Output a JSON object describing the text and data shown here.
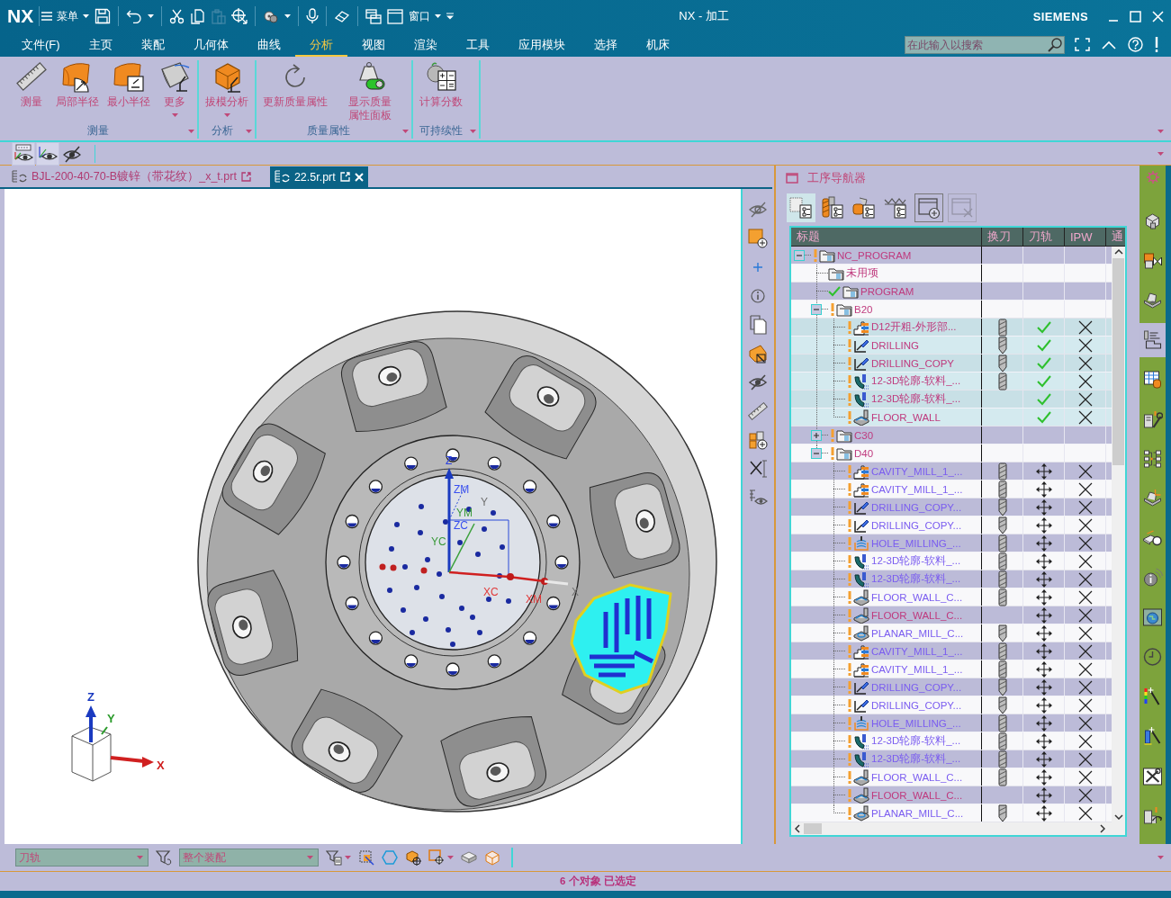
{
  "title_bar": {
    "logo": "NX",
    "menu_label": "菜单",
    "window_label": "窗口",
    "title": "NX - 加工",
    "brand": "SIEMENS"
  },
  "menu_bar": {
    "items": [
      {
        "label": "文件(F)",
        "selected": false
      },
      {
        "label": "主页",
        "selected": false
      },
      {
        "label": "装配",
        "selected": false
      },
      {
        "label": "几何体",
        "selected": false
      },
      {
        "label": "曲线",
        "selected": false
      },
      {
        "label": "分析",
        "selected": true
      },
      {
        "label": "视图",
        "selected": false
      },
      {
        "label": "渲染",
        "selected": false
      },
      {
        "label": "工具",
        "selected": false
      },
      {
        "label": "应用模块",
        "selected": false
      },
      {
        "label": "选择",
        "selected": false
      },
      {
        "label": "机床",
        "selected": false
      }
    ],
    "search": {
      "placeholder": "在此输入以搜索"
    }
  },
  "ribbon": {
    "groups": [
      {
        "label": "测量",
        "buttons": [
          {
            "label": "测量",
            "dropdown": false
          },
          {
            "label": "局部半径",
            "dropdown": false
          },
          {
            "label": "最小半径",
            "dropdown": false
          },
          {
            "label": "更多",
            "dropdown": true
          }
        ]
      },
      {
        "label": "分析",
        "buttons": [
          {
            "label": "拔模分析",
            "dropdown": true
          }
        ]
      },
      {
        "label": "质量属性",
        "buttons": [
          {
            "label": "更新质量属性",
            "dropdown": false
          },
          {
            "label": "显示质量属性面板",
            "dropdown": false
          }
        ]
      },
      {
        "label": "可持续性",
        "buttons": [
          {
            "label": "计算分数",
            "dropdown": false
          }
        ]
      }
    ]
  },
  "display_toolbar": {
    "toggles": [
      {
        "on": true
      },
      {
        "on": true
      },
      {
        "on": false
      }
    ]
  },
  "file_tabs": [
    {
      "label": "BJL-200-40-70-B镀锌（带花纹）_x_t.prt",
      "selected": false
    },
    {
      "label": "22.5r.prt",
      "selected": true
    }
  ],
  "viewport": {
    "axis_labels": [
      {
        "text": "Z",
        "color": "#2a40e0"
      },
      {
        "text": "ZM",
        "color": "#3a50f0"
      },
      {
        "text": "Y",
        "color": "#707070"
      },
      {
        "text": "YM",
        "color": "#3a9a3a"
      },
      {
        "text": "ZC",
        "color": "#3a50f0"
      },
      {
        "text": "YC",
        "color": "#3a9a3a"
      },
      {
        "text": "XC",
        "color": "#e03a3a"
      },
      {
        "text": "XM",
        "color": "#e03a3a"
      },
      {
        "text": "X",
        "color": "#707070"
      }
    ],
    "triad_labels": [
      {
        "text": "Z",
        "color": "#1a3ac0"
      },
      {
        "text": "Y",
        "color": "#2a9a2a"
      },
      {
        "text": "X",
        "color": "#d02020"
      }
    ]
  },
  "navigator": {
    "title": "工序导航器",
    "views": [
      {
        "selected": true
      },
      {
        "selected": false
      },
      {
        "selected": false
      },
      {
        "selected": false
      }
    ],
    "actions": [
      {
        "disabled": false
      },
      {
        "disabled": true
      }
    ],
    "columns": [
      "标题",
      "换刀",
      "刀轨",
      "IPW",
      "通"
    ],
    "rows": [
      {
        "name": "NC_PROGRAM",
        "kind": "folder",
        "warning": true,
        "done": false,
        "expanded": true,
        "selected": false,
        "color": "#bf3a7e",
        "children": [
          {
            "name": "未用项",
            "kind": "folder",
            "warning": false,
            "done": false,
            "selected": false,
            "color": "#bf3a7e"
          },
          {
            "name": "PROGRAM",
            "kind": "folder",
            "warning": false,
            "done": true,
            "selected": false,
            "color": "#bf3a7e"
          },
          {
            "name": "B20",
            "kind": "folder",
            "warning": true,
            "done": false,
            "expanded": true,
            "selected": false,
            "color": "#bf3a7e",
            "children": [
              {
                "name": "D12开粗-外形部...",
                "kind": "cavity",
                "warning": true,
                "done": false,
                "selected": true,
                "color": "#bf3a7e",
                "tool": {
                  "kind": "endmill"
                },
                "regenerate": false
              },
              {
                "name": "DRILLING",
                "kind": "drill",
                "warning": true,
                "done": false,
                "selected": true,
                "color": "#bf3a7e",
                "tool": {
                  "kind": "drill"
                },
                "regenerate": false
              },
              {
                "name": "DRILLING_COPY",
                "kind": "drill",
                "warning": true,
                "done": false,
                "selected": true,
                "color": "#bf3a7e",
                "tool": {
                  "kind": "drill"
                },
                "regenerate": false
              },
              {
                "name": "12-3D轮廓-软料_...",
                "kind": "contour",
                "warning": true,
                "done": false,
                "selected": true,
                "color": "#bf3a7e",
                "tool": {
                  "kind": "endmill"
                },
                "regenerate": false
              },
              {
                "name": "12-3D轮廓-软料_...",
                "kind": "contour",
                "warning": true,
                "done": false,
                "selected": true,
                "color": "#bf3a7e",
                "regenerate": false
              },
              {
                "name": "FLOOR_WALL",
                "kind": "floorwall",
                "warning": true,
                "done": false,
                "selected": true,
                "color": "#bf3a7e",
                "regenerate": false
              }
            ]
          },
          {
            "name": "C30",
            "kind": "folder",
            "warning": true,
            "done": false,
            "expanded": false,
            "selected": false,
            "color": "#bf3a7e"
          },
          {
            "name": "D40",
            "kind": "folder",
            "warning": true,
            "done": false,
            "expanded": true,
            "selected": false,
            "color": "#bf3a7e",
            "children": [
              {
                "name": "CAVITY_MILL_1_...",
                "kind": "cavity",
                "warning": true,
                "done": false,
                "selected": false,
                "color": "#7a5cf0",
                "tool": {
                  "kind": "endmill"
                },
                "regenerate": true
              },
              {
                "name": "CAVITY_MILL_1_...",
                "kind": "cavity",
                "warning": true,
                "done": false,
                "selected": false,
                "color": "#7a5cf0",
                "tool": {
                  "kind": "endmill"
                },
                "regenerate": true
              },
              {
                "name": "DRILLING_COPY...",
                "kind": "drill",
                "warning": true,
                "done": false,
                "selected": false,
                "color": "#7a5cf0",
                "tool": {
                  "kind": "drill"
                },
                "regenerate": true
              },
              {
                "name": "DRILLING_COPY...",
                "kind": "drill",
                "warning": true,
                "done": false,
                "selected": false,
                "color": "#7a5cf0",
                "tool": {
                  "kind": "drill"
                },
                "regenerate": true
              },
              {
                "name": "HOLE_MILLING_...",
                "kind": "holemill",
                "warning": true,
                "done": false,
                "selected": false,
                "color": "#7a5cf0",
                "tool": {
                  "kind": "endmill"
                },
                "regenerate": true
              },
              {
                "name": "12-3D轮廓-软料_...",
                "kind": "contour",
                "warning": true,
                "done": false,
                "selected": false,
                "color": "#7a5cf0",
                "tool": {
                  "kind": "endmill"
                },
                "regenerate": true
              },
              {
                "name": "12-3D轮廓-软料_...",
                "kind": "contour",
                "warning": true,
                "done": false,
                "selected": false,
                "color": "#7a5cf0",
                "tool": {
                  "kind": "endmill"
                },
                "regenerate": true
              },
              {
                "name": "FLOOR_WALL_C...",
                "kind": "floorwall",
                "warning": true,
                "done": false,
                "selected": false,
                "color": "#7a5cf0",
                "tool": {
                  "kind": "endmill"
                },
                "regenerate": true
              },
              {
                "name": "FLOOR_WALL_C...",
                "kind": "floorwall",
                "warning": true,
                "done": false,
                "selected": false,
                "color": "#bf3a7e",
                "regenerate": true
              },
              {
                "name": "PLANAR_MILL_C...",
                "kind": "planar",
                "warning": true,
                "done": false,
                "selected": false,
                "color": "#7a5cf0",
                "tool": {
                  "kind": "drill"
                },
                "regenerate": true
              },
              {
                "name": "CAVITY_MILL_1_...",
                "kind": "cavity",
                "warning": true,
                "done": false,
                "selected": false,
                "color": "#7a5cf0",
                "tool": {
                  "kind": "endmill"
                },
                "regenerate": true
              },
              {
                "name": "CAVITY_MILL_1_...",
                "kind": "cavity",
                "warning": true,
                "done": false,
                "selected": false,
                "color": "#7a5cf0",
                "tool": {
                  "kind": "endmill"
                },
                "regenerate": true
              },
              {
                "name": "DRILLING_COPY...",
                "kind": "drill",
                "warning": true,
                "done": false,
                "selected": false,
                "color": "#7a5cf0",
                "tool": {
                  "kind": "drill"
                },
                "regenerate": true
              },
              {
                "name": "DRILLING_COPY...",
                "kind": "drill",
                "warning": true,
                "done": false,
                "selected": false,
                "color": "#7a5cf0",
                "tool": {
                  "kind": "drill"
                },
                "regenerate": true
              },
              {
                "name": "HOLE_MILLING_...",
                "kind": "holemill",
                "warning": true,
                "done": false,
                "selected": false,
                "color": "#7a5cf0",
                "tool": {
                  "kind": "endmill"
                },
                "regenerate": true
              },
              {
                "name": "12-3D轮廓-软料_...",
                "kind": "contour",
                "warning": true,
                "done": false,
                "selected": false,
                "color": "#7a5cf0",
                "tool": {
                  "kind": "endmill"
                },
                "regenerate": true
              },
              {
                "name": "12-3D轮廓-软料_...",
                "kind": "contour",
                "warning": true,
                "done": false,
                "selected": false,
                "color": "#7a5cf0",
                "tool": {
                  "kind": "endmill"
                },
                "regenerate": true
              },
              {
                "name": "FLOOR_WALL_C...",
                "kind": "floorwall",
                "warning": true,
                "done": false,
                "selected": false,
                "color": "#7a5cf0",
                "tool": {
                  "kind": "endmill"
                },
                "regenerate": true
              },
              {
                "name": "FLOOR_WALL_C...",
                "kind": "floorwall",
                "warning": true,
                "done": false,
                "selected": false,
                "color": "#bf3a7e",
                "regenerate": true
              },
              {
                "name": "PLANAR_MILL_C...",
                "kind": "planar",
                "warning": true,
                "done": false,
                "selected": false,
                "color": "#7a5cf0",
                "tool": {
                  "kind": "drill"
                },
                "regenerate": true
              }
            ]
          }
        ]
      }
    ]
  },
  "resource_bar": {
    "tabs": [
      {
        "selected": false
      },
      {
        "selected": false
      },
      {
        "selected": false
      },
      {
        "selected": true
      },
      {
        "selected": false
      },
      {
        "selected": false
      },
      {
        "selected": false
      },
      {
        "selected": false
      },
      {
        "selected": false
      },
      {
        "selected": false
      },
      {
        "selected": false
      },
      {
        "selected": false
      },
      {
        "selected": false
      },
      {
        "selected": false
      },
      {
        "selected": false
      },
      {
        "selected": false
      }
    ]
  },
  "selection_bar": {
    "type_filter": "刀轨",
    "scope_filter": "整个装配"
  },
  "status_bar": {
    "message": "6 个对象 已选定"
  }
}
